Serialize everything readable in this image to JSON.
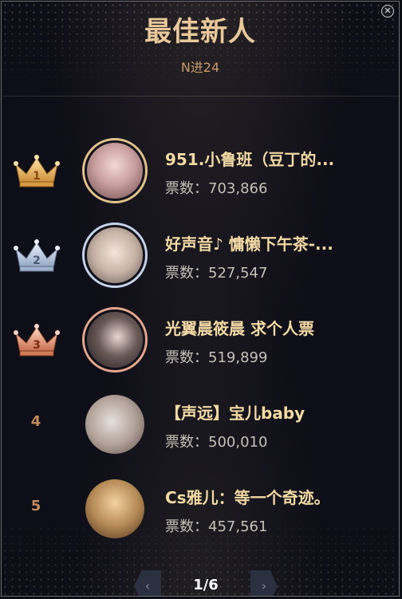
{
  "header": {
    "title": "最佳新人",
    "subtitle": "N进24",
    "close_icon": "close-icon"
  },
  "ranking": [
    {
      "rank": "1",
      "badge": "gold-crown",
      "name": "951.小鲁班（豆丁的...",
      "votes_label": "票数：",
      "votes": "703,866",
      "ring_color": "#e2c28c",
      "avatar_tint": "#caa0a0"
    },
    {
      "rank": "2",
      "badge": "silver-crown",
      "name": "好声音♪ 慵懒下午茶-...",
      "votes_label": "票数：",
      "votes": "527,547",
      "ring_color": "#c5d2e8",
      "avatar_tint": "#c8b2a6"
    },
    {
      "rank": "3",
      "badge": "bronze-crown",
      "name": "光翼晨筱晨 求个人票",
      "votes_label": "票数：",
      "votes": "519,899",
      "ring_color": "#e3a68c",
      "avatar_tint": "#6a5a58"
    },
    {
      "rank": "4",
      "badge": "none",
      "name": "【声远】宝儿baby",
      "votes_label": "票数：",
      "votes": "500,010",
      "ring_color": "none",
      "avatar_tint": "#b3a39a"
    },
    {
      "rank": "5",
      "badge": "none",
      "name": "Cs雅儿：等一个奇迹。",
      "votes_label": "票数：",
      "votes": "457,561",
      "ring_color": "none",
      "avatar_tint": "#b58a55"
    }
  ],
  "pagination": {
    "label": "1/6",
    "prev_icon": "chevron-left-icon",
    "next_icon": "chevron-right-icon"
  },
  "colors": {
    "background": "#0e0e18",
    "title": "#e9c99b",
    "name": "#f3d9a4",
    "votes": "#c5c0b6"
  }
}
